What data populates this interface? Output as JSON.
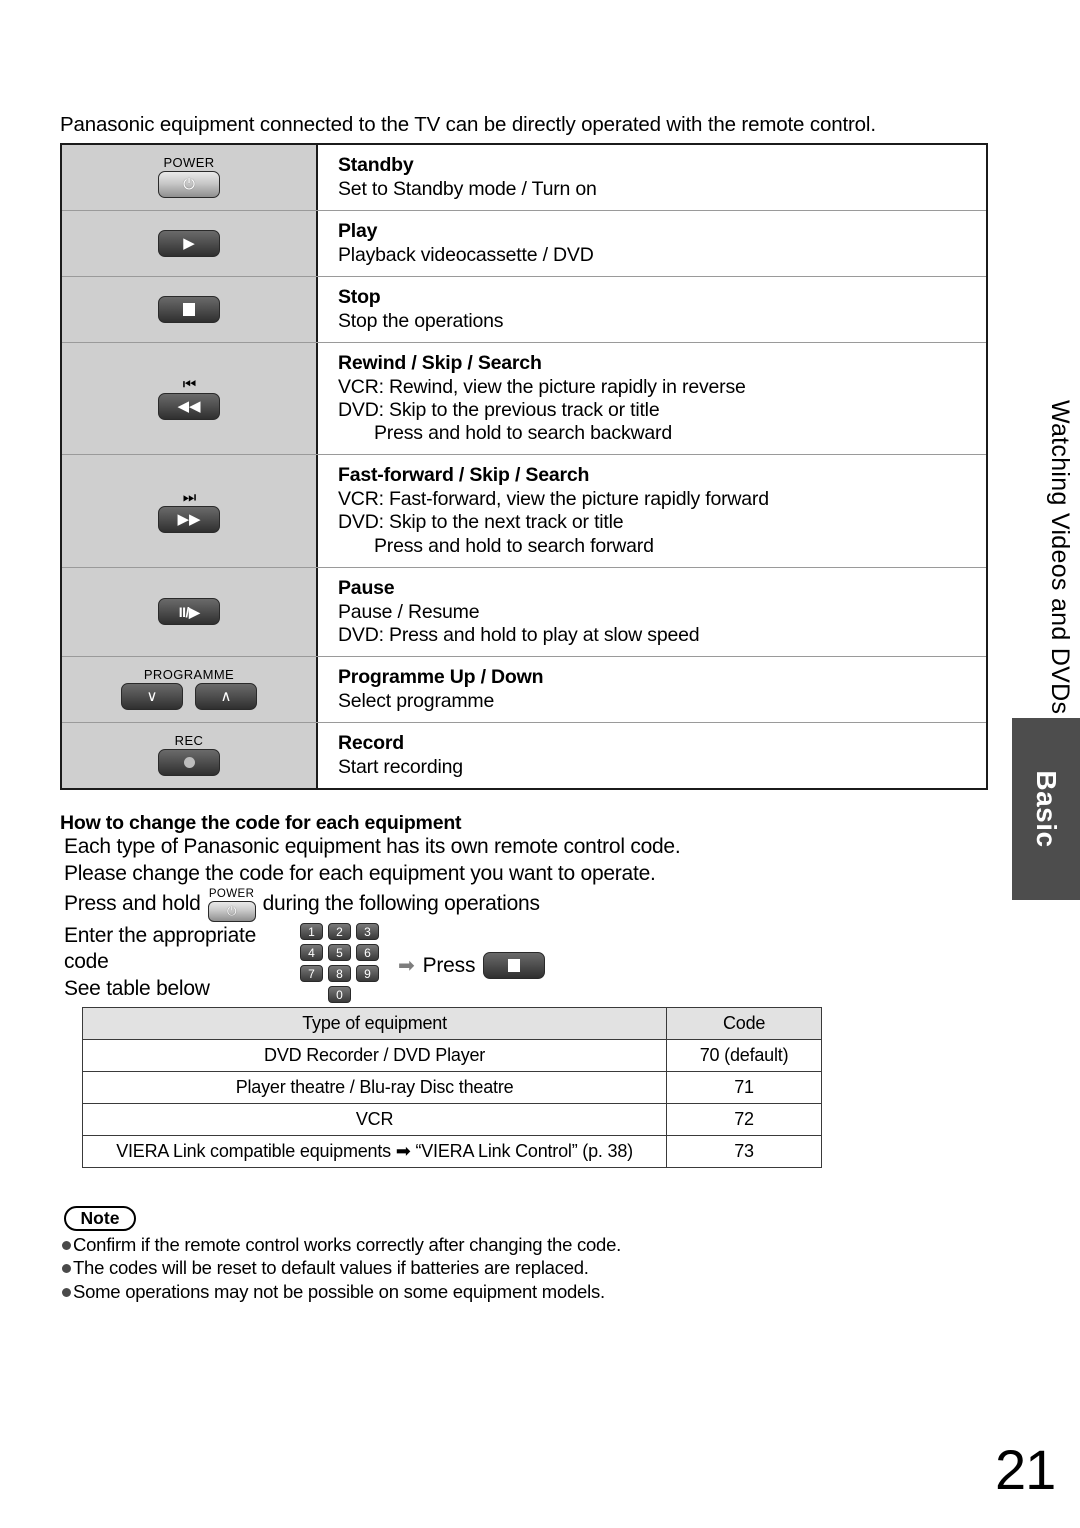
{
  "intro": "Panasonic equipment connected to the TV can be directly operated with the remote control.",
  "side": {
    "section_label": "Watching Videos and DVDs",
    "tab_label": "Basic"
  },
  "page_number": "21",
  "operations": [
    {
      "key_label": "POWER",
      "key_icon": "power-icon",
      "key_glyph": "⏻",
      "key_style": "light",
      "skip_mark": "",
      "title": "Standby",
      "lines": [
        {
          "text": "Set to Standby mode / Turn on",
          "indent": false
        }
      ]
    },
    {
      "key_label": "",
      "key_icon": "play-icon",
      "key_glyph": "▶",
      "key_style": "dark",
      "skip_mark": "",
      "title": "Play",
      "lines": [
        {
          "text": "Playback videocassette / DVD",
          "indent": false
        }
      ]
    },
    {
      "key_label": "",
      "key_icon": "stop-icon",
      "key_glyph": "",
      "key_style": "dark",
      "skip_mark": "",
      "title": "Stop",
      "lines": [
        {
          "text": "Stop the operations",
          "indent": false
        }
      ]
    },
    {
      "key_label": "",
      "key_icon": "rewind-icon",
      "key_glyph": "◀◀",
      "key_style": "dark",
      "skip_mark": "⏮",
      "title": "Rewind / Skip / Search",
      "lines": [
        {
          "text": "VCR: Rewind, view the picture rapidly in reverse",
          "indent": false
        },
        {
          "text": "DVD: Skip to the previous track or title",
          "indent": false
        },
        {
          "text": "Press and hold to search backward",
          "indent": true
        }
      ]
    },
    {
      "key_label": "",
      "key_icon": "fast-forward-icon",
      "key_glyph": "▶▶",
      "key_style": "dark",
      "skip_mark": "⏭",
      "title": "Fast-forward / Skip / Search",
      "lines": [
        {
          "text": "VCR: Fast-forward, view the picture rapidly forward",
          "indent": false
        },
        {
          "text": "DVD: Skip to the next track or title",
          "indent": false
        },
        {
          "text": "Press and hold to search forward",
          "indent": true
        }
      ]
    },
    {
      "key_label": "",
      "key_icon": "pause-play-icon",
      "key_glyph": "II/▶",
      "key_style": "dark",
      "skip_mark": "",
      "title": "Pause",
      "lines": [
        {
          "text": "Pause / Resume",
          "indent": false
        },
        {
          "text": "DVD: Press and hold to play at slow speed",
          "indent": false
        }
      ]
    },
    {
      "key_label": "PROGRAMME",
      "key_icon": "programme-down-up-icon",
      "key_glyph": "",
      "key_glyph_down": "∨",
      "key_glyph_up": "∧",
      "key_style": "dark",
      "skip_mark": "",
      "title": "Programme Up / Down",
      "lines": [
        {
          "text": "Select programme",
          "indent": false
        }
      ]
    },
    {
      "key_label": "REC",
      "key_icon": "record-icon",
      "key_glyph": "",
      "key_style": "dark",
      "skip_mark": "",
      "title": "Record",
      "lines": [
        {
          "text": "Start recording",
          "indent": false
        }
      ]
    }
  ],
  "howto": {
    "heading": "How to change the code for each equipment",
    "line1": "Each type of Panasonic equipment has its own remote control code.",
    "line2": "Please change the code for each equipment you want to operate.",
    "line3_before": "Press and hold",
    "line3_after": "during the following operations",
    "power_key_label": "POWER",
    "enter_line1": "Enter the appropriate",
    "enter_line2": "code",
    "enter_line3": "See table below",
    "keypad": [
      [
        "1",
        "2",
        "3"
      ],
      [
        "4",
        "5",
        "6"
      ],
      [
        "7",
        "8",
        "9"
      ],
      [
        "0"
      ]
    ],
    "arrow": "➡",
    "press_label": "Press"
  },
  "code_table": {
    "headers": [
      "Type of equipment",
      "Code"
    ],
    "rows": [
      {
        "equipment": "DVD Recorder / DVD Player",
        "code": "70 (default)"
      },
      {
        "equipment": "Player theatre / Blu-ray Disc theatre",
        "code": "71"
      },
      {
        "equipment": "VCR",
        "code": "72"
      },
      {
        "equipment": "VIERA Link compatible equipments ➡ “VIERA Link Control” (p. 38)",
        "code": "73"
      }
    ]
  },
  "note": {
    "badge": "Note",
    "items": [
      "Confirm if the remote control works correctly after changing the code.",
      "The codes will be reset to default values if batteries are replaced.",
      "Some operations may not be possible on some equipment models."
    ]
  }
}
